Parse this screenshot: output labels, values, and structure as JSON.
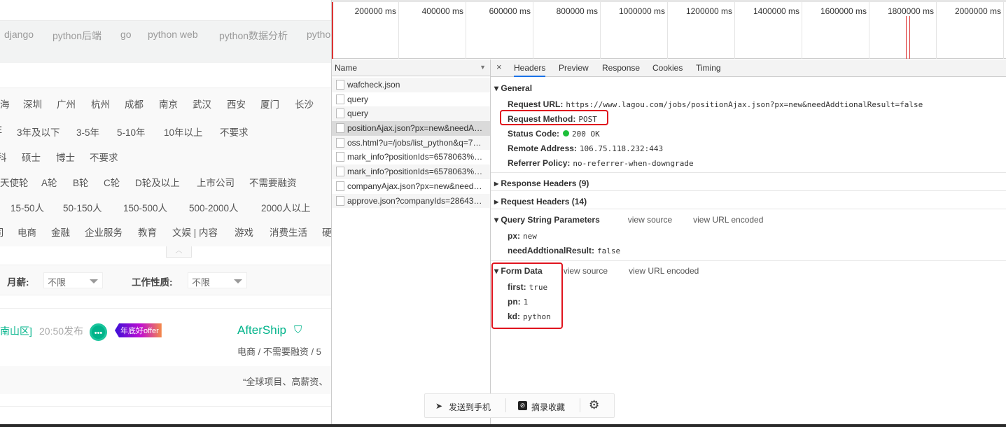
{
  "left_page": {
    "tags": [
      "django",
      "python后端",
      "go",
      "python web",
      "python数据分析",
      "pytho"
    ],
    "cities": [
      "海",
      "深圳",
      "广州",
      "杭州",
      "成都",
      "南京",
      "武汉",
      "西安",
      "厦门",
      "长沙"
    ],
    "experience": [
      "E",
      "3年及以下",
      "3-5年",
      "5-10年",
      "10年以上",
      "不要求"
    ],
    "education": [
      "科",
      "硕士",
      "博士",
      "不要求"
    ],
    "financing": [
      "天使轮",
      "A轮",
      "B轮",
      "C轮",
      "D轮及以上",
      "上市公司",
      "不需要融资"
    ],
    "company_size": [
      "15-50人",
      "50-150人",
      "150-500人",
      "500-2000人",
      "2000人以上"
    ],
    "industry": [
      "司",
      "电商",
      "金融",
      "企业服务",
      "教育",
      "文娱 | 内容",
      "游戏",
      "消费生活",
      "硬"
    ],
    "salary_label": "月薪:",
    "salary_value": "不限",
    "job_type_label": "工作性质:",
    "job_type_value": "不限",
    "job": {
      "location": "南山区]",
      "time": "20:50发布",
      "badge": "年底好offer",
      "company": "AfterShip",
      "company_info": "电商 / 不需要融资 / 5",
      "quote": "“全球项目、高薪资、"
    },
    "accent": "#00b38a"
  },
  "devtools": {
    "timeline_ticks": [
      "200000 ms",
      "400000 ms",
      "600000 ms",
      "800000 ms",
      "1000000 ms",
      "1200000 ms",
      "1400000 ms",
      "1600000 ms",
      "1800000 ms",
      "2000000 ms"
    ],
    "name_header": "Name",
    "requests": [
      "wafcheck.json",
      "query",
      "query",
      "positionAjax.json?px=new&needA…",
      "oss.html?u=/jobs/list_python&q=7…",
      "mark_info?positionIds=6578063%…",
      "mark_info?positionIds=6578063%…",
      "companyAjax.json?px=new&need…",
      "approve.json?companyIds=28643…"
    ],
    "tabs": [
      "Headers",
      "Preview",
      "Response",
      "Cookies",
      "Timing"
    ],
    "close": "×",
    "general": {
      "title": "General",
      "rows": [
        [
          "Request URL:",
          "https://www.lagou.com/jobs/positionAjax.json?px=new&needAddtionalResult=false"
        ],
        [
          "Request Method:",
          "POST"
        ],
        [
          "Status Code:",
          "200 OK"
        ],
        [
          "Remote Address:",
          "106.75.118.232:443"
        ],
        [
          "Referrer Policy:",
          "no-referrer-when-downgrade"
        ]
      ]
    },
    "response_headers": "Response Headers (9)",
    "request_headers": "Request Headers (14)",
    "query": {
      "title": "Query String Parameters",
      "view_source": "view source",
      "view_encoded": "view URL encoded",
      "rows": [
        [
          "px:",
          "new"
        ],
        [
          "needAddtionalResult:",
          "false"
        ]
      ]
    },
    "form": {
      "title": "Form Data",
      "view_source": "view source",
      "view_encoded": "view URL encoded",
      "rows": [
        [
          "first:",
          "true"
        ],
        [
          "pn:",
          "1"
        ],
        [
          "kd:",
          "python"
        ]
      ]
    }
  },
  "toolbar": {
    "send": "发送到手机",
    "collect": "摘录收藏"
  }
}
